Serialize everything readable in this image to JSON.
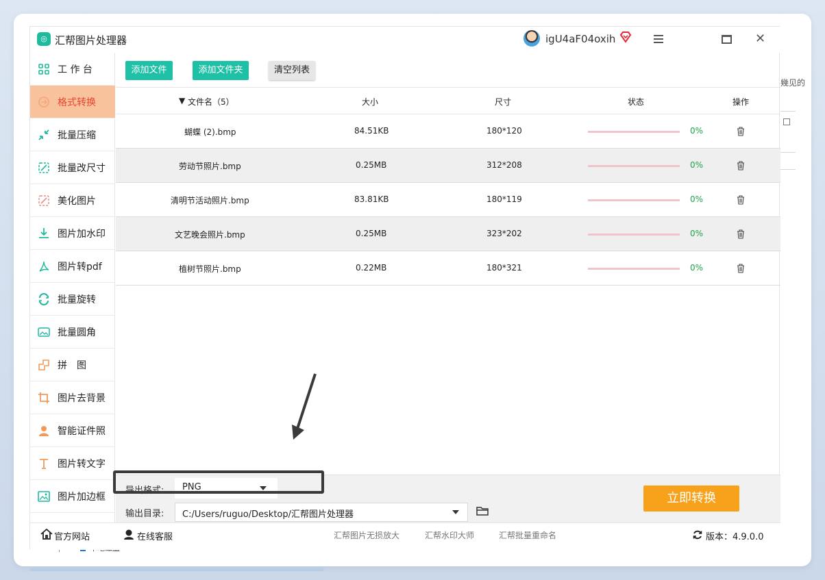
{
  "app": {
    "title": "汇帮图片处理器",
    "username": "igU4aF04oxih"
  },
  "sidebar": {
    "items": [
      {
        "label": "工 作 台",
        "icon": "grid-icon"
      },
      {
        "label": "格式转换",
        "icon": "convert-icon",
        "active": true
      },
      {
        "label": "批量压缩",
        "icon": "compress-icon"
      },
      {
        "label": "批量改尺寸",
        "icon": "resize-icon"
      },
      {
        "label": "美化图片",
        "icon": "beautify-icon"
      },
      {
        "label": "图片加水印",
        "icon": "watermark-icon"
      },
      {
        "label": "图片转pdf",
        "icon": "pdf-icon"
      },
      {
        "label": "批量旋转",
        "icon": "rotate-icon"
      },
      {
        "label": "批量圆角",
        "icon": "round-corner-icon"
      },
      {
        "label": "拼　图",
        "icon": "puzzle-icon"
      },
      {
        "label": "图片去背景",
        "icon": "crop-icon"
      },
      {
        "label": "智能证件照",
        "icon": "person-icon"
      },
      {
        "label": "图片转文字",
        "icon": "text-icon"
      },
      {
        "label": "图片加边框",
        "icon": "frame-icon"
      }
    ]
  },
  "toolbar": {
    "add_file": "添加文件",
    "add_folder": "添加文件夹",
    "clear_list": "清空列表"
  },
  "table": {
    "headers": {
      "name": "文件名（5）",
      "size": "大小",
      "dimension": "尺寸",
      "status": "状态",
      "action": "操作"
    },
    "rows": [
      {
        "name": "蝴蝶 (2).bmp",
        "size": "84.51KB",
        "dimension": "180*120",
        "progress": "0%"
      },
      {
        "name": "劳动节照片.bmp",
        "size": "0.25MB",
        "dimension": "312*208",
        "progress": "0%"
      },
      {
        "name": "清明节活动照片.bmp",
        "size": "83.81KB",
        "dimension": "180*119",
        "progress": "0%"
      },
      {
        "name": "文艺晚会照片.bmp",
        "size": "0.25MB",
        "dimension": "323*202",
        "progress": "0%"
      },
      {
        "name": "植树节照片.bmp",
        "size": "0.22MB",
        "dimension": "180*321",
        "progress": "0%"
      }
    ]
  },
  "export": {
    "format_label": "导出格式:",
    "format_value": "PNG",
    "output_label": "输出目录:",
    "output_value": "C:/Users/ruguo/Desktop/汇帮图片处理器",
    "convert_button": "立即转换"
  },
  "footer": {
    "website": "官方网站",
    "support": "在线客服",
    "links": [
      "汇帮图片无损放大",
      "汇帮水印大师",
      "汇帮批量重命名"
    ],
    "version": "版本：4.9.0.0"
  },
  "background": {
    "peek_text": "幾见的",
    "peek_under": "本地磁盘"
  },
  "colors": {
    "accent_green": "#1fc1a6",
    "active_bg": "#f8c39c",
    "convert_orange": "#f8a21c",
    "progress_pink": "#f3c3cc"
  }
}
